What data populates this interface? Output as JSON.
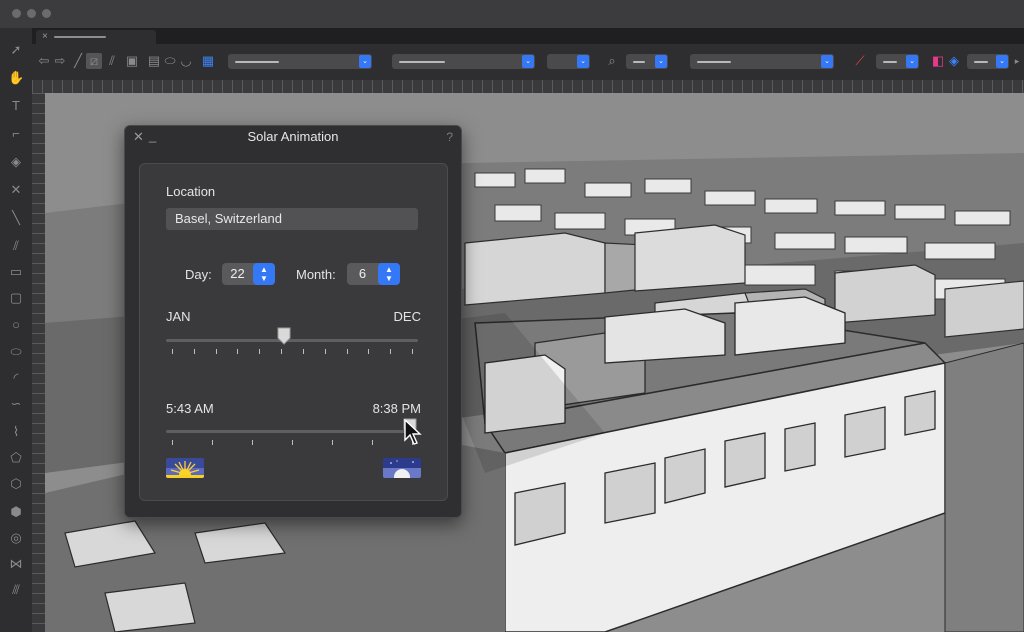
{
  "window": {
    "document_tab": "",
    "traffic_lights": [
      "close",
      "minimize",
      "zoom"
    ]
  },
  "toolbar": {
    "dropdowns": [
      {
        "name": "class-dropdown"
      },
      {
        "name": "layer-dropdown"
      },
      {
        "name": "units-dropdown"
      },
      {
        "name": "zoom-dropdown"
      },
      {
        "name": "view-dropdown"
      },
      {
        "name": "render-dropdown"
      },
      {
        "name": "projection-dropdown"
      }
    ]
  },
  "solar_panel": {
    "title": "Solar Animation",
    "help": "?",
    "location_label": "Location",
    "location_value": "Basel, Switzerland",
    "day_label": "Day:",
    "day_value": "22",
    "month_label": "Month:",
    "month_value": "6",
    "month_start_label": "JAN",
    "month_end_label": "DEC",
    "month_slider_position": 0.47,
    "time_start_label": "5:43 AM",
    "time_end_label": "8:38 PM",
    "time_slider_position": 0.97,
    "sunrise_icon": "sunrise-icon",
    "sunset_icon": "moonrise-icon",
    "accent_color": "#3478f6"
  }
}
